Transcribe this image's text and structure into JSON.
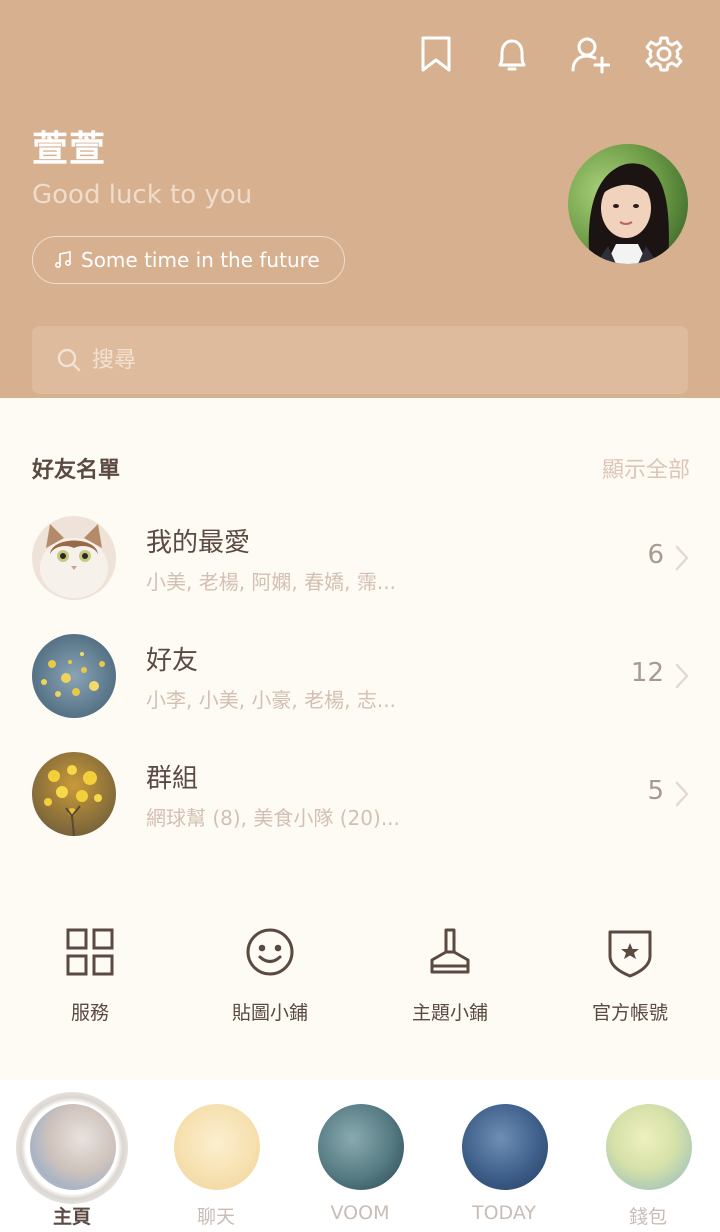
{
  "header": {
    "name": "萱萱",
    "status_message": "Good luck to you",
    "music": "Some time in the future",
    "search_placeholder": "搜尋",
    "icons": [
      "bookmark-icon",
      "bell-icon",
      "add-friend-icon",
      "gear-icon"
    ]
  },
  "friends": {
    "title": "好友名單",
    "show_all": "顯示全部",
    "rows": [
      {
        "title": "我的最愛",
        "subtitle": "小美, 老楊, 阿嫻, 春嬌, 霈...",
        "count": "6"
      },
      {
        "title": "好友",
        "subtitle": "小李, 小美, 小豪, 老楊, 志...",
        "count": "12"
      },
      {
        "title": "群組",
        "subtitle": "網球幫 (8), 美食小隊 (20)...",
        "count": "5"
      }
    ]
  },
  "services": [
    {
      "label": "服務",
      "icon": "grid-icon"
    },
    {
      "label": "貼圖小鋪",
      "icon": "smiley-icon"
    },
    {
      "label": "主題小鋪",
      "icon": "brush-icon"
    },
    {
      "label": "官方帳號",
      "icon": "shield-star-icon"
    }
  ],
  "nav": [
    {
      "label": "主頁",
      "active": true
    },
    {
      "label": "聊天",
      "active": false
    },
    {
      "label": "VOOM",
      "active": false
    },
    {
      "label": "TODAY",
      "active": false
    },
    {
      "label": "錢包",
      "active": false
    }
  ],
  "colors": {
    "header_bg": "#d7b08f",
    "body_bg": "#fdfbf3",
    "text_dark": "#5b4a42",
    "text_muted": "#d4c0b2"
  }
}
